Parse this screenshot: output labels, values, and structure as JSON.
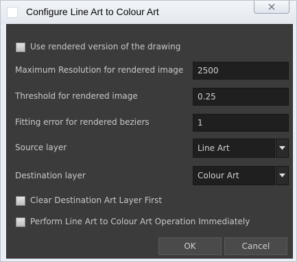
{
  "window": {
    "title": "Configure Line Art to Colour Art"
  },
  "options": {
    "use_rendered_label": "Use rendered version of the drawing",
    "use_rendered_checked": false,
    "clear_destination_label": "Clear Destination Art Layer First",
    "clear_destination_checked": false,
    "perform_immediately_label": "Perform Line Art to Colour Art Operation Immediately",
    "perform_immediately_checked": false
  },
  "fields": {
    "max_resolution": {
      "label": "Maximum Resolution for rendered image",
      "value": "2500"
    },
    "threshold": {
      "label": "Threshold for rendered image",
      "value": "0.25"
    },
    "fitting_error": {
      "label": "Fitting error for rendered beziers",
      "value": "1"
    }
  },
  "selects": {
    "source_layer": {
      "label": "Source layer",
      "value": "Line Art"
    },
    "destination_layer": {
      "label": "Destination layer",
      "value": "Colour Art"
    }
  },
  "buttons": {
    "ok": "OK",
    "cancel": "Cancel"
  },
  "colors": {
    "dialog_bg": "#3b3b3b",
    "field_bg": "#1f1f1f",
    "text": "#c9c9c9",
    "frame": "#e9eef4"
  }
}
